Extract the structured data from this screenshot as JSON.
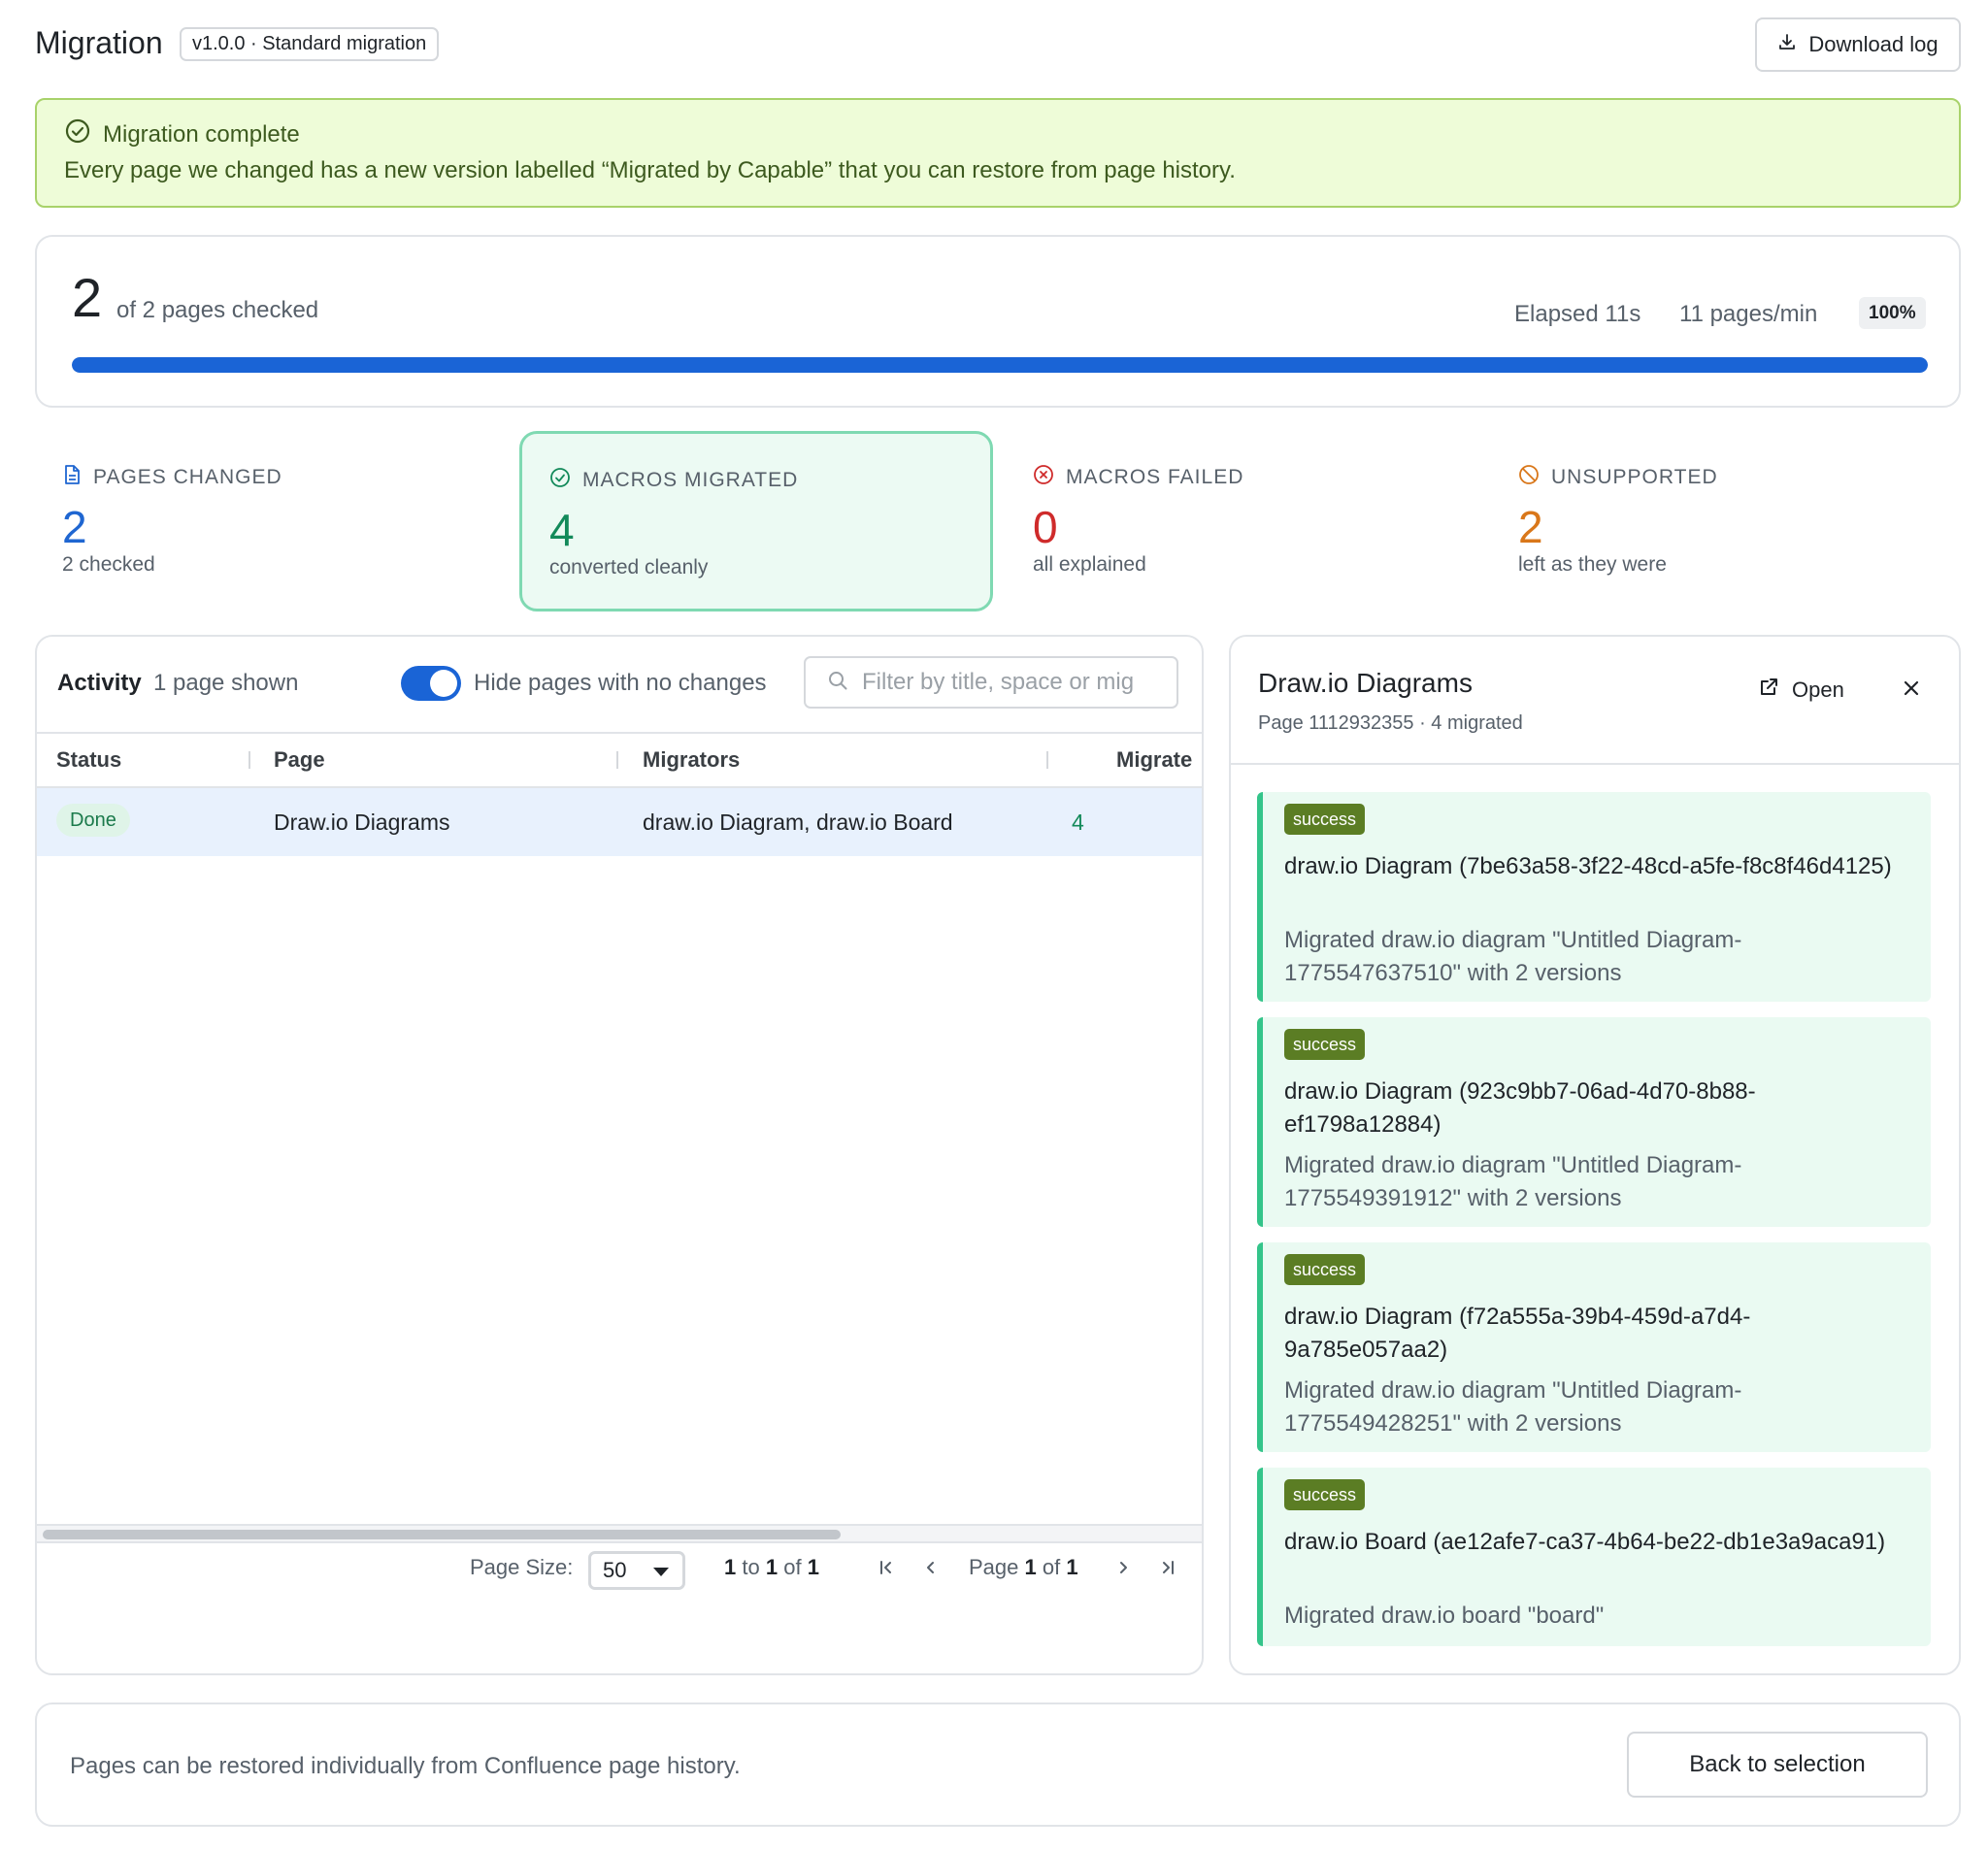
{
  "header": {
    "title": "Migration",
    "version_badge": "v1.0.0 · Standard migration",
    "download_label": "Download log"
  },
  "banner": {
    "title": "Migration complete",
    "message": "Every page we changed has a new version labelled “Migrated by Capable” that you can restore from page history."
  },
  "progress": {
    "checked": "2",
    "suffix": "of 2 pages checked",
    "elapsed": "Elapsed 11s",
    "rate": "11 pages/min",
    "percent_label": "100%",
    "percent": 100,
    "bar_color": "#1a64d6"
  },
  "stats": [
    {
      "label": "PAGES CHANGED",
      "value": "2",
      "sub": "2 checked",
      "color": "#1f66d1",
      "icon": "document-icon"
    },
    {
      "label": "MACROS MIGRATED",
      "value": "4",
      "sub": "converted cleanly",
      "color": "#138a5a",
      "icon": "check-circle-icon"
    },
    {
      "label": "MACROS FAILED",
      "value": "0",
      "sub": "all explained",
      "color": "#cf2b2b",
      "icon": "x-circle-icon"
    },
    {
      "label": "UNSUPPORTED",
      "value": "2",
      "sub": "left as they were",
      "color": "#d9771a",
      "icon": "ban-icon"
    }
  ],
  "activity": {
    "title": "Activity",
    "count": "1 page shown",
    "toggle_label": "Hide pages with no changes",
    "toggle_on": true,
    "filter_placeholder": "Filter by title, space or mig",
    "columns": [
      "Status",
      "Page",
      "Migrators",
      "Migrate"
    ],
    "rows": [
      {
        "status": "Done",
        "page": "Draw.io Diagrams",
        "migrators": "draw.io Diagram, draw.io Board",
        "migrated": "4"
      }
    ],
    "pager": {
      "page_size_label": "Page Size:",
      "page_size": "50",
      "range_from": "1",
      "range_to_word": "to",
      "range_to": "1",
      "of_word": "of",
      "range_total": "1",
      "page_word": "Page",
      "page_current": "1",
      "page_total": "1"
    }
  },
  "detail": {
    "title": "Draw.io Diagrams",
    "subtitle": "Page 1112932355 · 4 migrated",
    "open_label": "Open",
    "results": [
      {
        "tag": "success",
        "title": "draw.io Diagram (7be63a58-3f22-48cd-a5fe-f8c8f46d4125)",
        "desc": "Migrated draw.io diagram \"Untitled Diagram-1775547637510\" with 2 versions"
      },
      {
        "tag": "success",
        "title": "draw.io Diagram (923c9bb7-06ad-4d70-8b88-ef1798a12884)",
        "desc": "Migrated draw.io diagram \"Untitled Diagram-1775549391912\" with 2 versions"
      },
      {
        "tag": "success",
        "title": "draw.io Diagram (f72a555a-39b4-459d-a7d4-9a785e057aa2)",
        "desc": "Migrated draw.io diagram \"Untitled Diagram-1775549428251\" with 2 versions"
      },
      {
        "tag": "success",
        "title": "draw.io Board (ae12afe7-ca37-4b64-be22-db1e3a9aca91)",
        "desc": "Migrated draw.io board \"board\""
      }
    ]
  },
  "footer": {
    "message": "Pages can be restored individually from Confluence page history.",
    "back_label": "Back to selection"
  }
}
